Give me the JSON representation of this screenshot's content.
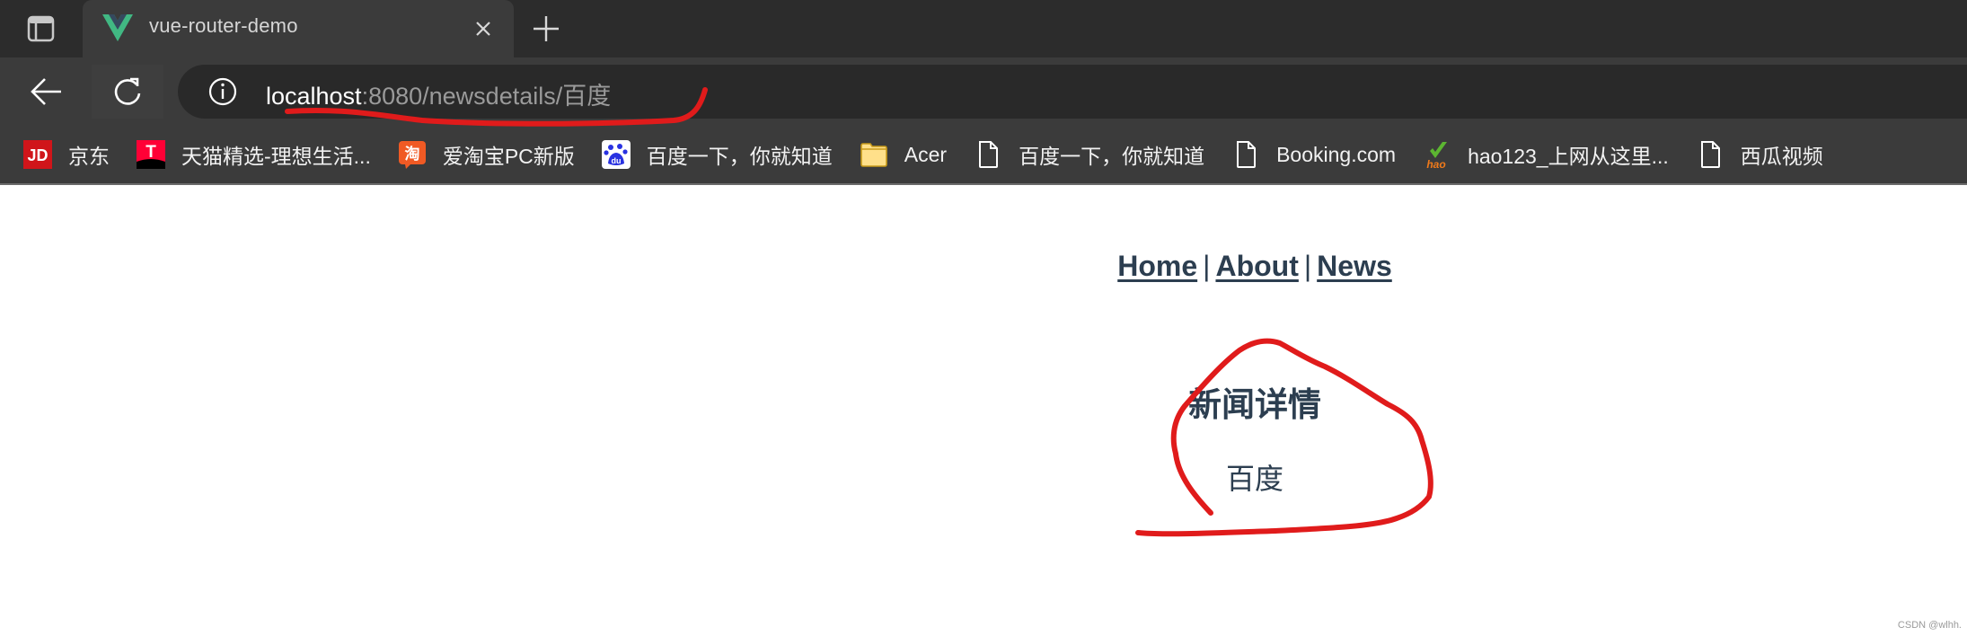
{
  "browser": {
    "tab": {
      "title": "vue-router-demo",
      "favicon": "vue-logo-icon"
    },
    "new_tab_icon": "plus-icon",
    "close_tab_icon": "close-icon",
    "address_bar": {
      "site_info_icon": "info-icon",
      "url_host": "localhost",
      "url_rest": ":8080/newsdetails/百度"
    },
    "bookmarks": [
      {
        "label": "京东",
        "icon": "jd-icon"
      },
      {
        "label": "天猫精选-理想生活...",
        "icon": "tmall-icon"
      },
      {
        "label": "爱淘宝PC新版",
        "icon": "taobao-icon"
      },
      {
        "label": "百度一下，你就知道",
        "icon": "baidu-icon"
      },
      {
        "label": "Acer",
        "icon": "folder-icon"
      },
      {
        "label": "百度一下，你就知道",
        "icon": "page-icon"
      },
      {
        "label": "Booking.com",
        "icon": "page-icon"
      },
      {
        "label": "hao123_上网从这里...",
        "icon": "hao123-icon"
      },
      {
        "label": "西瓜视频",
        "icon": "page-icon"
      }
    ]
  },
  "page": {
    "nav": {
      "links": [
        "Home",
        "About",
        "News"
      ],
      "separator": "|"
    },
    "heading": "新闻详情",
    "detail_text": "百度",
    "text_color": "#2c3e50"
  },
  "annotation": {
    "color": "#e01b1b",
    "marks": [
      "url-underline",
      "content-circle"
    ]
  },
  "watermark": "CSDN @wlhh."
}
